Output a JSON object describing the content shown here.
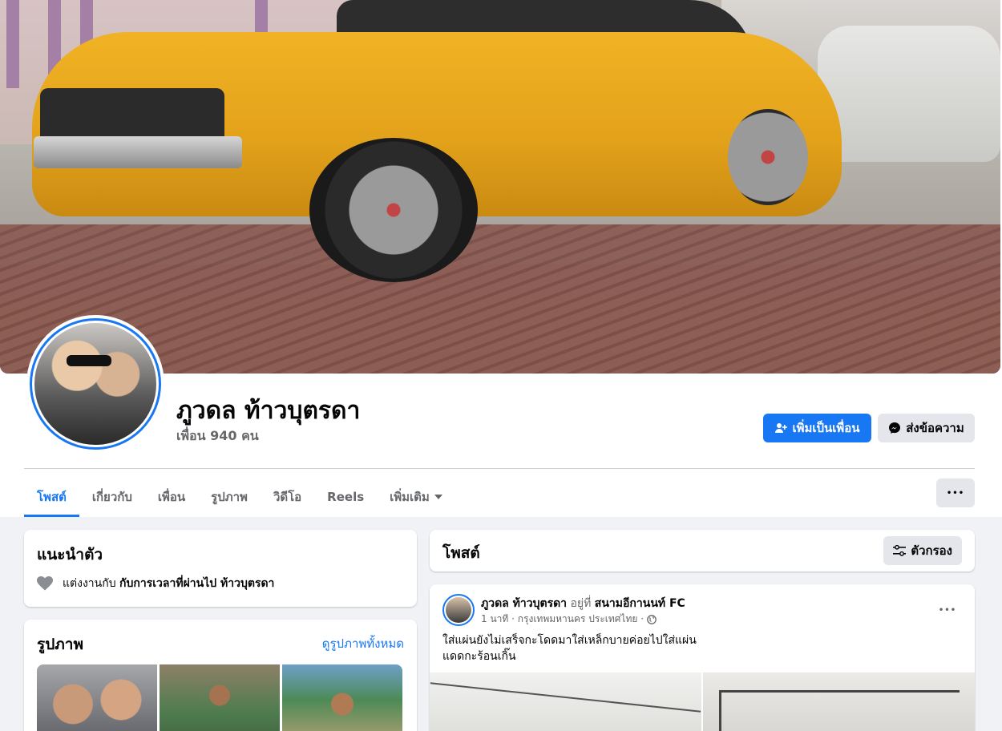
{
  "profile": {
    "name": "ภูวดล ท้าวบุตรดา",
    "friends": "เพื่อน 940 คน",
    "add_friend_label": "เพิ่มเป็นเพื่อน",
    "message_label": "ส่งข้อความ"
  },
  "tabs": [
    {
      "label": "โพสต์",
      "active": true
    },
    {
      "label": "เกี่ยวกับ"
    },
    {
      "label": "เพื่อน"
    },
    {
      "label": "รูปภาพ"
    },
    {
      "label": "วิดีโอ"
    },
    {
      "label": "Reels"
    },
    {
      "label": "เพิ่มเติม"
    }
  ],
  "more_glyph": "•••",
  "intro": {
    "title": "แนะนำตัว",
    "relationship_prefix": "แต่งงานกับ",
    "relationship_partner": "กับการเวลาที่ผ่านไป ท้าวบุตรดา"
  },
  "photos": {
    "title": "รูปภาพ",
    "see_all": "ดูรูปภาพทั้งหมด"
  },
  "posts": {
    "title": "โพสต์",
    "filter_label": "ตัวกรอง"
  },
  "post": {
    "author": "ภูวดล ท้าวบุตรดา",
    "at_word": "อยู่ที่",
    "place": "สนามอีกานนท์ FC",
    "meta": "1 นาที · กรุงเทพมหานคร ประเทศไทย ·",
    "text_line1": "ใส่แผ่นยังไม่เสร็จกะโดดมาใส่เหล็กบายค่อยไปใส่แผ่น",
    "text_line2": "แดดกะร้อนเกิ๊น"
  },
  "colors": {
    "accent": "#1877f2",
    "background": "#f0f2f5",
    "muted_text": "#65676b"
  }
}
